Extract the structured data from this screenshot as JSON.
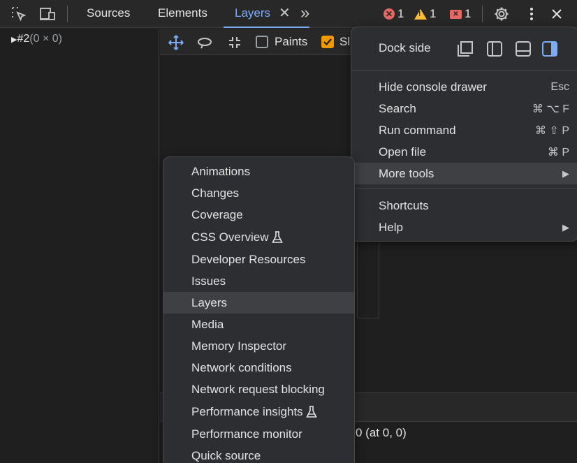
{
  "toolbar": {
    "tabs": [
      {
        "label": "Sources"
      },
      {
        "label": "Elements"
      },
      {
        "label": "Layers"
      }
    ],
    "tab_close_glyph": "✕",
    "more_tabs_glyph": "»",
    "errors_count": "1",
    "warnings_count": "1",
    "issues_count": "1",
    "icons": [
      "inspect-element-icon",
      "device-toolbar-icon",
      "settings-gear-icon",
      "kebab-menu-icon",
      "close-icon"
    ],
    "accent": "#7cacf8"
  },
  "tree": {
    "item_id": "#2",
    "item_size": "(0 × 0)"
  },
  "layers_toolbar": {
    "paints_label": "Paints",
    "slow_label_fragment": "Sl",
    "paints_checked": false,
    "slow_checked": true
  },
  "details": {
    "text": "0 (at 0, 0)"
  },
  "main_menu": {
    "dock_side_label": "Dock side",
    "items": [
      {
        "label": "Hide console drawer",
        "shortcut": "Esc"
      },
      {
        "label": "Search",
        "shortcut": "⌘ ⌥ F"
      },
      {
        "label": "Run command",
        "shortcut": "⌘ ⇧ P"
      },
      {
        "label": "Open file",
        "shortcut": "⌘ P"
      },
      {
        "label": "More tools",
        "shortcut": "▶"
      },
      {
        "label": "Shortcuts",
        "shortcut": ""
      },
      {
        "label": "Help",
        "shortcut": "▶"
      }
    ]
  },
  "more_tools_menu": {
    "items": [
      {
        "label": "Animations"
      },
      {
        "label": "Changes"
      },
      {
        "label": "Coverage"
      },
      {
        "label": "CSS Overview",
        "experimental": true
      },
      {
        "label": "Developer Resources"
      },
      {
        "label": "Issues"
      },
      {
        "label": "Layers"
      },
      {
        "label": "Media"
      },
      {
        "label": "Memory Inspector"
      },
      {
        "label": "Network conditions"
      },
      {
        "label": "Network request blocking"
      },
      {
        "label": "Performance insights",
        "experimental": true
      },
      {
        "label": "Performance monitor"
      },
      {
        "label": "Quick source"
      }
    ]
  }
}
